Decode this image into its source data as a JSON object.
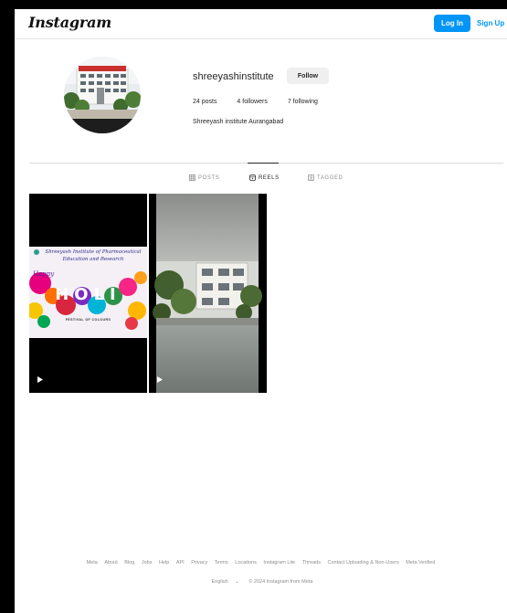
{
  "header": {
    "logo": "Instagram",
    "login_label": "Log In",
    "signup_label": "Sign Up"
  },
  "profile": {
    "username": "shreeyashinstitute",
    "follow_label": "Follow",
    "posts": "24 posts",
    "followers": "4 followers",
    "following": "7 following",
    "bio": "Shreeyash institute Aurangabad"
  },
  "tabs": [
    {
      "label": "POSTS",
      "active": false,
      "icon": "grid-icon"
    },
    {
      "label": "REELS",
      "active": true,
      "icon": "reels-icon"
    },
    {
      "label": "TAGGED",
      "active": false,
      "icon": "tagged-icon"
    }
  ],
  "posts": [
    {
      "type": "reel",
      "banner_line1": "Shreeyash Institute of Pharmaceutical",
      "banner_line2": "Education and Research",
      "happy": "Happy",
      "holi": "HOLI",
      "tagline": "FESTIVAL OF COLOURS"
    },
    {
      "type": "reel"
    }
  ],
  "footer": {
    "links": [
      "Meta",
      "About",
      "Blog",
      "Jobs",
      "Help",
      "API",
      "Privacy",
      "Terms",
      "Locations",
      "Instagram Lite",
      "Threads",
      "Contact Uploading & Non-Users",
      "Meta Verified"
    ],
    "language": "English",
    "copyright": "© 2024 Instagram from Meta"
  },
  "colors": {
    "accent": "#0095f6",
    "text": "#262626",
    "muted": "#8e8e8e"
  }
}
